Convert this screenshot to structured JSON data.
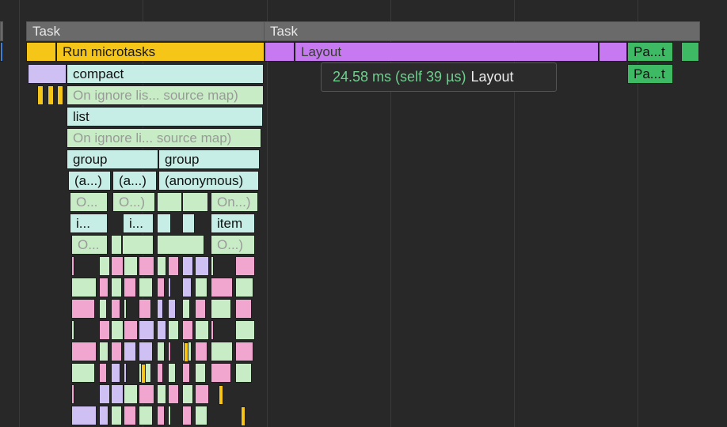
{
  "flame_chart": {
    "task_1_label": "Task",
    "task_2_label": "Task",
    "run_microtasks_label": "Run microtasks",
    "layout_label": "Layout",
    "paint_1_label": "Pa...t",
    "paint_2_label": "Pa...t",
    "compact_label": "compact",
    "ignore_1_label": "On ignore lis... source map)",
    "list_label": "list",
    "ignore_2_label": "On ignore li... source map)",
    "group_1_label": "group",
    "group_2_label": "group",
    "anon_1_label": "(a...)",
    "anon_2_label": "(a...)",
    "anon_3_label": "(anonymous)",
    "o_1_label": "O...",
    "o_2_label": "O...)",
    "on_label": "On...)",
    "i_1_label": "i...",
    "i_2_label": "i...",
    "item_label": "item",
    "o_3_label": "O...",
    "o_4_label": "O...)"
  },
  "tooltip": {
    "time": "24.58 ms (self 39 µs)",
    "name": "Layout"
  },
  "colors": {
    "background": "#282828",
    "task": "#6a6a6a",
    "scripting_yellow": "#f5c518",
    "rendering_purple": "#c679f0",
    "painting_green": "#3dba63",
    "function_teal": "#c6ede6",
    "function_green": "#c8ecc6",
    "function_pink": "#f1a6cf",
    "function_lavender": "#cfc0f3"
  }
}
